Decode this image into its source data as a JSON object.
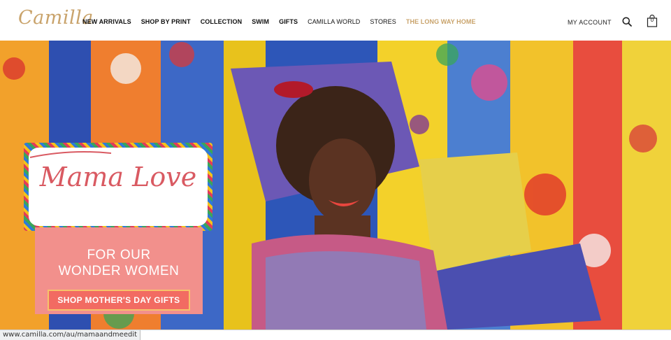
{
  "header": {
    "logo": "Camilla",
    "nav": [
      {
        "label": "NEW ARRIVALS"
      },
      {
        "label": "SHOP BY PRINT"
      },
      {
        "label": "COLLECTION"
      },
      {
        "label": "SWIM"
      },
      {
        "label": "GIFTS"
      },
      {
        "label": "CAMILLA WORLD"
      },
      {
        "label": "STORES"
      },
      {
        "label": "THE LONG WAY HOME"
      }
    ],
    "account_label": "MY ACCOUNT",
    "search_icon": "search-icon",
    "bag_icon": "shopping-bag-icon",
    "bag_count": "0"
  },
  "hero": {
    "title": "Mama Love",
    "line1": "FOR OUR",
    "line2": "WONDER WOMEN",
    "cta_label": "SHOP MOTHER'S DAY GIFTS",
    "colors": {
      "promo": "#f2908c",
      "cta": "#f26b62",
      "title": "#d95a62",
      "gold": "#c9a36b"
    }
  },
  "status_bar": {
    "url": "www.camilla.com/au/mamaandmeedit"
  }
}
